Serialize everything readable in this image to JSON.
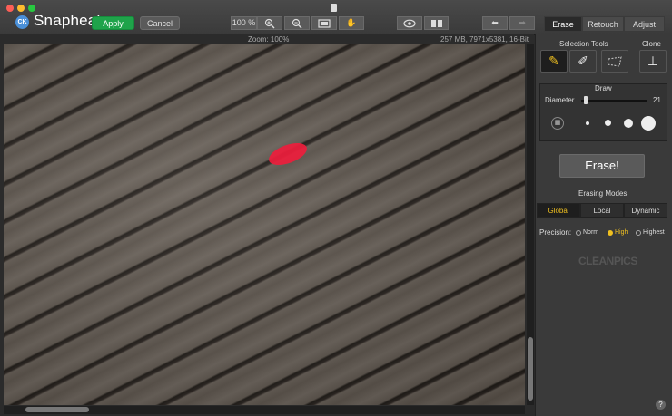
{
  "app": {
    "name": "Snapheal",
    "version": "CK"
  },
  "toolbar": {
    "apply_label": "Apply",
    "cancel_label": "Cancel",
    "zoom_value": "100 %"
  },
  "tabs": [
    "Erase",
    "Retouch",
    "Adjust"
  ],
  "info": {
    "zoom_label": "Zoom: 100%",
    "image_info": "257 MB, 7971x5381, 16-Bit"
  },
  "panel": {
    "selection_tools_label": "Selection Tools",
    "clone_label": "Clone",
    "draw_label": "Draw",
    "diameter_label": "Diameter",
    "diameter_value": "21",
    "diameter_level": 0.04,
    "erase_button_label": "Erase!",
    "erasing_modes_label": "Erasing Modes",
    "modes": [
      "Global",
      "Local",
      "Dynamic"
    ],
    "active_mode": "Global",
    "precision_label": "Precision:",
    "precision_options": [
      "Norm",
      "High",
      "Highest"
    ],
    "active_precision": "High",
    "brand_logo": "CLEANPICS",
    "help_label": "?"
  },
  "colors": {
    "apply_green": "#1fa34a",
    "active_yellow": "#f0c020",
    "mark_red": "#ee1d3c"
  }
}
